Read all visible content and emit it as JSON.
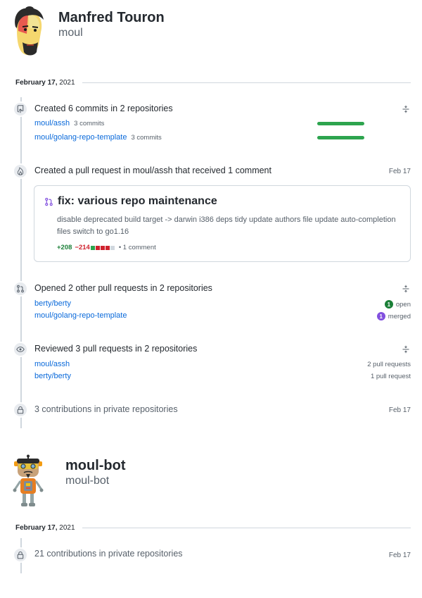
{
  "users": [
    {
      "name": "Manfred Touron",
      "login": "moul",
      "date": {
        "month_day": "February 17,",
        "year": "2021"
      }
    },
    {
      "name": "moul-bot",
      "login": "moul-bot",
      "date": {
        "month_day": "February 17,",
        "year": "2021"
      }
    }
  ],
  "events": {
    "commits": {
      "title": "Created 6 commits in 2 repositories",
      "repos": [
        {
          "name": "moul/assh",
          "count": "3 commits",
          "bar_fraction": 1.0
        },
        {
          "name": "moul/golang-repo-template",
          "count": "3 commits",
          "bar_fraction": 1.0
        }
      ]
    },
    "pull_request": {
      "title": "Created a pull request in moul/assh that received 1 comment",
      "date": "Feb 17",
      "card": {
        "title": "fix: various repo maintenance",
        "body": "disable deprecated build target -> darwin i386 deps tidy update authors file update auto-completion files switch to go1.16",
        "additions": "+208",
        "deletions": "−214",
        "diff_blocks": [
          "#2da44e",
          "#cf222e",
          "#cf222e",
          "#cf222e",
          "#d0d7de"
        ],
        "comments": "• 1 comment"
      }
    },
    "opened": {
      "title": "Opened 2 other pull requests in 2 repositories",
      "repos": [
        {
          "name": "berty/berty",
          "badge_count": "1",
          "status": "open",
          "status_color": "#1a7f37"
        },
        {
          "name": "moul/golang-repo-template",
          "badge_count": "1",
          "status": "merged",
          "status_color": "#8250df"
        }
      ]
    },
    "reviewed": {
      "title": "Reviewed 3 pull requests in 2 repositories",
      "repos": [
        {
          "name": "moul/assh",
          "count": "2 pull requests"
        },
        {
          "name": "berty/berty",
          "count": "1 pull request"
        }
      ]
    },
    "private": {
      "title": "3 contributions in private repositories",
      "date": "Feb 17"
    },
    "bot_private": {
      "title": "21 contributions in private repositories",
      "date": "Feb 17"
    }
  },
  "icons": {
    "commits": "repo-push-icon",
    "pull_request": "flame-icon",
    "opened": "git-pull-request-icon",
    "reviewed": "eye-icon",
    "private": "lock-icon",
    "toggle": "fold-icon",
    "pr_card": "git-pull-request-icon"
  }
}
